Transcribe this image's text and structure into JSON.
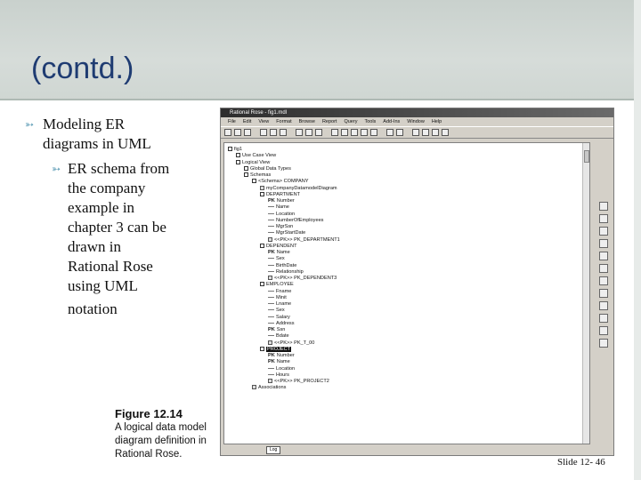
{
  "slide": {
    "title": "(contd.)",
    "bullet_main": [
      "Modeling ER",
      "diagrams in UML"
    ],
    "bullet_sub": [
      "ER schema from",
      "the company",
      "example in",
      "chapter 3 can be",
      "drawn in",
      "Rational Rose",
      "using UML",
      "notation"
    ],
    "figure_number": "Figure 12.14",
    "figure_caption": [
      "A logical data model",
      "diagram definition in",
      "Rational Rose."
    ],
    "slide_number": "Slide 12- 46"
  },
  "window": {
    "title": "Rational Rose - fig1.mdl",
    "menu": [
      "File",
      "Edit",
      "View",
      "Format",
      "Browse",
      "Report",
      "Query",
      "Tools",
      "Add-Ins",
      "Window",
      "Help"
    ],
    "log_tab": "Log"
  },
  "tree": [
    {
      "indent": 0,
      "kind": "box",
      "text": "fig1"
    },
    {
      "indent": 1,
      "kind": "box",
      "text": "Use Case View"
    },
    {
      "indent": 1,
      "kind": "box",
      "text": "Logical View"
    },
    {
      "indent": 2,
      "kind": "box",
      "text": "Global Data Types"
    },
    {
      "indent": 2,
      "kind": "box",
      "text": "Schemas"
    },
    {
      "indent": 3,
      "kind": "box",
      "text": "<Schema> COMPANY"
    },
    {
      "indent": 4,
      "kind": "ico",
      "text": "myCompanyDatamodelDiagram"
    },
    {
      "indent": 4,
      "kind": "box",
      "text": "DEPARTMENT"
    },
    {
      "indent": 5,
      "kind": "key",
      "key": "PK",
      "text": "Number"
    },
    {
      "indent": 5,
      "kind": "leaf",
      "text": "Name"
    },
    {
      "indent": 5,
      "kind": "leaf",
      "text": "Location"
    },
    {
      "indent": 5,
      "kind": "leaf",
      "text": "NumberOfEmployees"
    },
    {
      "indent": 5,
      "kind": "leaf",
      "text": "MgrSsn"
    },
    {
      "indent": 5,
      "kind": "leaf",
      "text": "MgrStartDate"
    },
    {
      "indent": 5,
      "kind": "ico",
      "text": "<<PK>> PK_DEPARTMENT1"
    },
    {
      "indent": 4,
      "kind": "box",
      "text": "DEPENDENT"
    },
    {
      "indent": 5,
      "kind": "key",
      "key": "PK",
      "text": "Name"
    },
    {
      "indent": 5,
      "kind": "leaf",
      "text": "Sex"
    },
    {
      "indent": 5,
      "kind": "leaf",
      "text": "BirthDate"
    },
    {
      "indent": 5,
      "kind": "leaf",
      "text": "Relationship"
    },
    {
      "indent": 5,
      "kind": "ico",
      "text": "<<PK>> PK_DEPENDENT3"
    },
    {
      "indent": 4,
      "kind": "box",
      "text": "EMPLOYEE"
    },
    {
      "indent": 5,
      "kind": "leaf",
      "text": "Fname"
    },
    {
      "indent": 5,
      "kind": "leaf",
      "text": "Minit"
    },
    {
      "indent": 5,
      "kind": "leaf",
      "text": "Lname"
    },
    {
      "indent": 5,
      "kind": "leaf",
      "text": "Sex"
    },
    {
      "indent": 5,
      "kind": "leaf",
      "text": "Salary"
    },
    {
      "indent": 5,
      "kind": "leaf",
      "text": "Address"
    },
    {
      "indent": 5,
      "kind": "key",
      "key": "PK",
      "text": "Ssn"
    },
    {
      "indent": 5,
      "kind": "leaf",
      "text": "Bdate"
    },
    {
      "indent": 5,
      "kind": "ico",
      "text": "<<PK>> PK_T_00"
    },
    {
      "indent": 4,
      "kind": "box",
      "text": "PROJECT",
      "highlight": true
    },
    {
      "indent": 5,
      "kind": "key",
      "key": "PK",
      "text": "Number"
    },
    {
      "indent": 5,
      "kind": "key",
      "key": "PK",
      "text": "Name"
    },
    {
      "indent": 5,
      "kind": "leaf",
      "text": "Location"
    },
    {
      "indent": 5,
      "kind": "leaf",
      "text": "Hours"
    },
    {
      "indent": 5,
      "kind": "ico",
      "text": "<<PK>> PK_PROJECT2"
    },
    {
      "indent": 3,
      "kind": "ico",
      "text": "Associations"
    }
  ]
}
